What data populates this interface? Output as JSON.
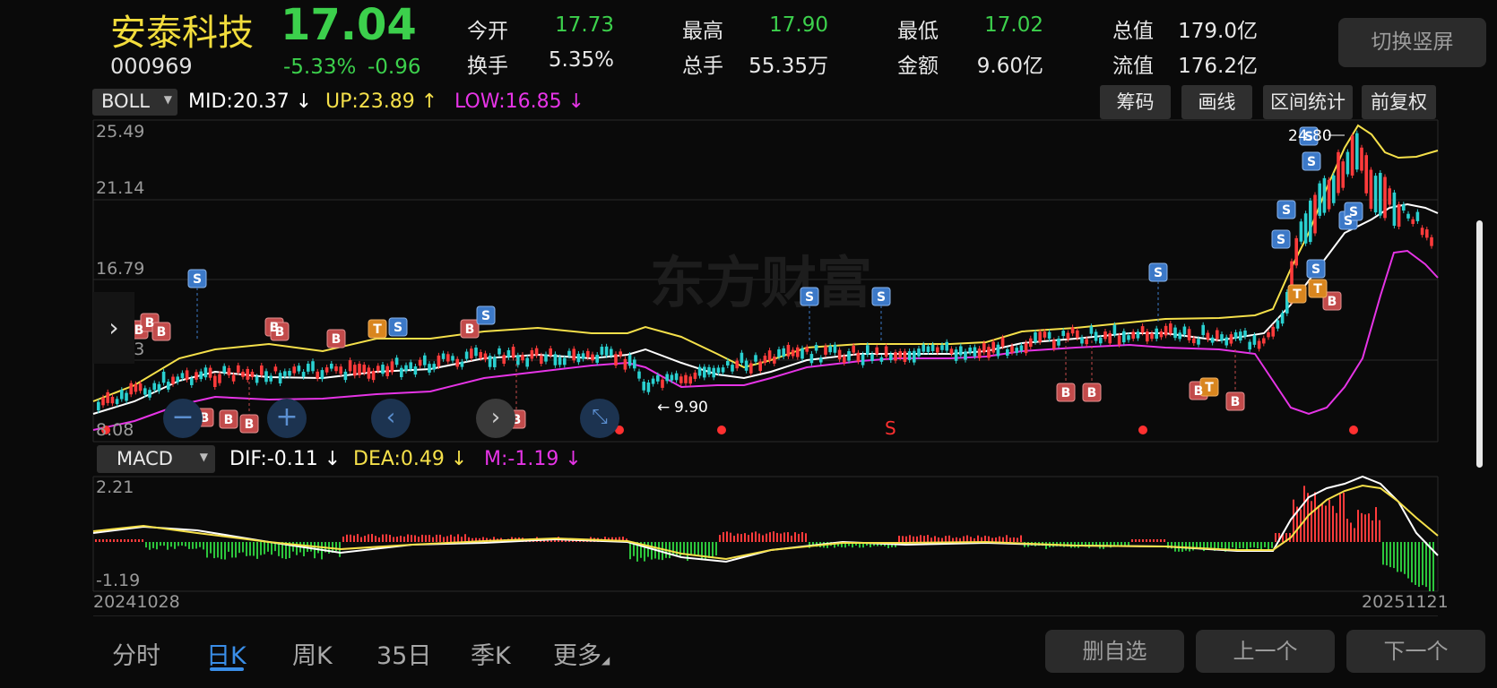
{
  "header": {
    "stock_name": "安泰科技",
    "price": "17.04",
    "code": "000969",
    "change_pct": "-5.33%",
    "change_amt": "-0.96",
    "switch_button": "切换竖屏",
    "quotes": [
      {
        "label": "今开",
        "value": "17.73",
        "color": "green"
      },
      {
        "label": "最高",
        "value": "17.90",
        "color": "green"
      },
      {
        "label": "最低",
        "value": "17.02",
        "color": "green"
      },
      {
        "label": "总值",
        "value": "179.0亿",
        "color": "white"
      },
      {
        "label": "换手",
        "value": "5.35%",
        "color": "white"
      },
      {
        "label": "总手",
        "value": "55.35万",
        "color": "white"
      },
      {
        "label": "金额",
        "value": "9.60亿",
        "color": "white"
      },
      {
        "label": "流值",
        "value": "176.2亿",
        "color": "white"
      }
    ]
  },
  "main_indicator": {
    "name": "BOLL",
    "mid": "MID:20.37",
    "up": "UP:23.89",
    "low": "LOW:16.85",
    "buttons": [
      "筹码",
      "画线",
      "区间统计",
      "前复权"
    ],
    "y_labels": [
      "25.49",
      "21.14",
      "16.79",
      "12.43",
      "8.08"
    ],
    "high_marker": "24.80",
    "low_marker": "9.90",
    "watermark": "东方财富"
  },
  "sub_indicator": {
    "name": "MACD",
    "dif": "DIF:-0.11",
    "dea": "DEA:0.49",
    "m": "M:-1.19",
    "y_labels": [
      "2.21",
      "-1.19"
    ]
  },
  "dates": {
    "start": "20241028",
    "end": "20251121"
  },
  "tabs": [
    "分时",
    "日K",
    "周K",
    "35日",
    "季K",
    "更多"
  ],
  "active_tab": "日K",
  "bottom_buttons": [
    "删自选",
    "上一个",
    "下一个"
  ],
  "colors": {
    "up": "#ff3b3b",
    "down": "#2ad0d0",
    "price_green": "#3cd04c",
    "accent": "#3a8ee8",
    "name_yellow": "#f2dd3c"
  }
}
